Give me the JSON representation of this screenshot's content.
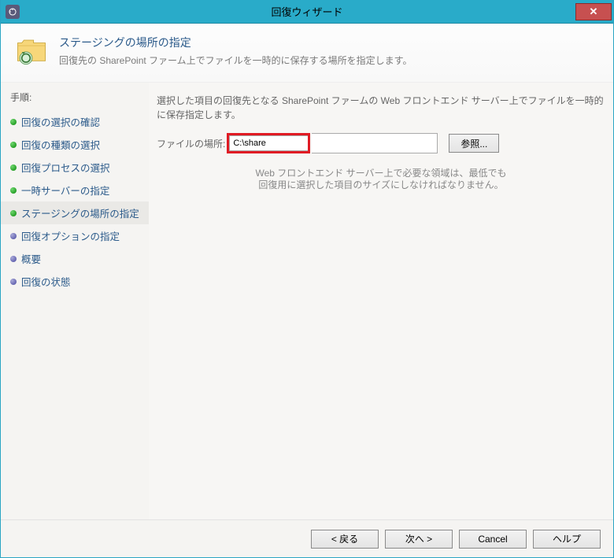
{
  "window": {
    "title": "回復ウィザード"
  },
  "header": {
    "title": "ステージングの場所の指定",
    "subtitle": "回復先の SharePoint ファーム上でファイルを一時的に保存する場所を指定します。"
  },
  "sidebar": {
    "steps_label": "手順:",
    "steps": [
      {
        "label": "回復の選択の確認",
        "state": "done"
      },
      {
        "label": "回復の種類の選択",
        "state": "done"
      },
      {
        "label": "回復プロセスの選択",
        "state": "done"
      },
      {
        "label": "一時サーバーの指定",
        "state": "done"
      },
      {
        "label": "ステージングの場所の指定",
        "state": "current"
      },
      {
        "label": "回復オプションの指定",
        "state": "pending"
      },
      {
        "label": "概要",
        "state": "pending"
      },
      {
        "label": "回復の状態",
        "state": "pending"
      }
    ]
  },
  "main": {
    "description": "選択した項目の回復先となる SharePoint ファームの Web フロントエンド サーバー上でファイルを一時的に保存指定します。",
    "file_location_label": "ファイルの場所:",
    "file_location_value": "C:\\share",
    "browse_label": "参照...",
    "hint_line1": "Web フロントエンド サーバー上で必要な領域は、最低でも",
    "hint_line2": "回復用に選択した項目のサイズにしなければなりません。"
  },
  "footer": {
    "back": "< 戻る",
    "next": "次へ >",
    "cancel": "Cancel",
    "help": "ヘルプ"
  }
}
